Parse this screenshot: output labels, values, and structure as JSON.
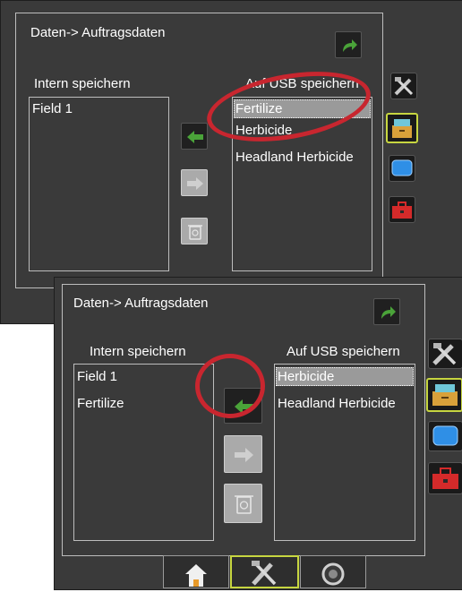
{
  "screen1": {
    "title": "Daten-> Auftragsdaten",
    "left_header": "Intern speichern",
    "right_header": "Auf USB speichern",
    "left_items": [
      "Field 1"
    ],
    "right_items": [
      "Fertilize",
      "Herbicide",
      "Headland Herbicide"
    ],
    "selected_right": "Fertilize"
  },
  "screen2": {
    "title": "Daten-> Auftragsdaten",
    "left_header": "Intern speichern",
    "right_header": "Auf USB speichern",
    "left_items": [
      "Field 1",
      "Fertilize"
    ],
    "right_items": [
      "Herbicide",
      "Headland Herbicide"
    ],
    "selected_right": "Herbicide"
  },
  "icons": {
    "back": "return-arrow-icon",
    "copy_left": "arrow-left-icon",
    "copy_right": "arrow-right-icon",
    "delete": "recycle-bin-icon",
    "tools": "tools-icon",
    "data": "file-cabinet-icon",
    "display": "monitor-icon",
    "toolbox": "toolbox-icon",
    "home": "home-icon",
    "gauge": "gauge-icon"
  },
  "colors": {
    "accent": "#c7d640",
    "arrow_green": "#4aa339",
    "highlight_ring": "#c8262f"
  }
}
